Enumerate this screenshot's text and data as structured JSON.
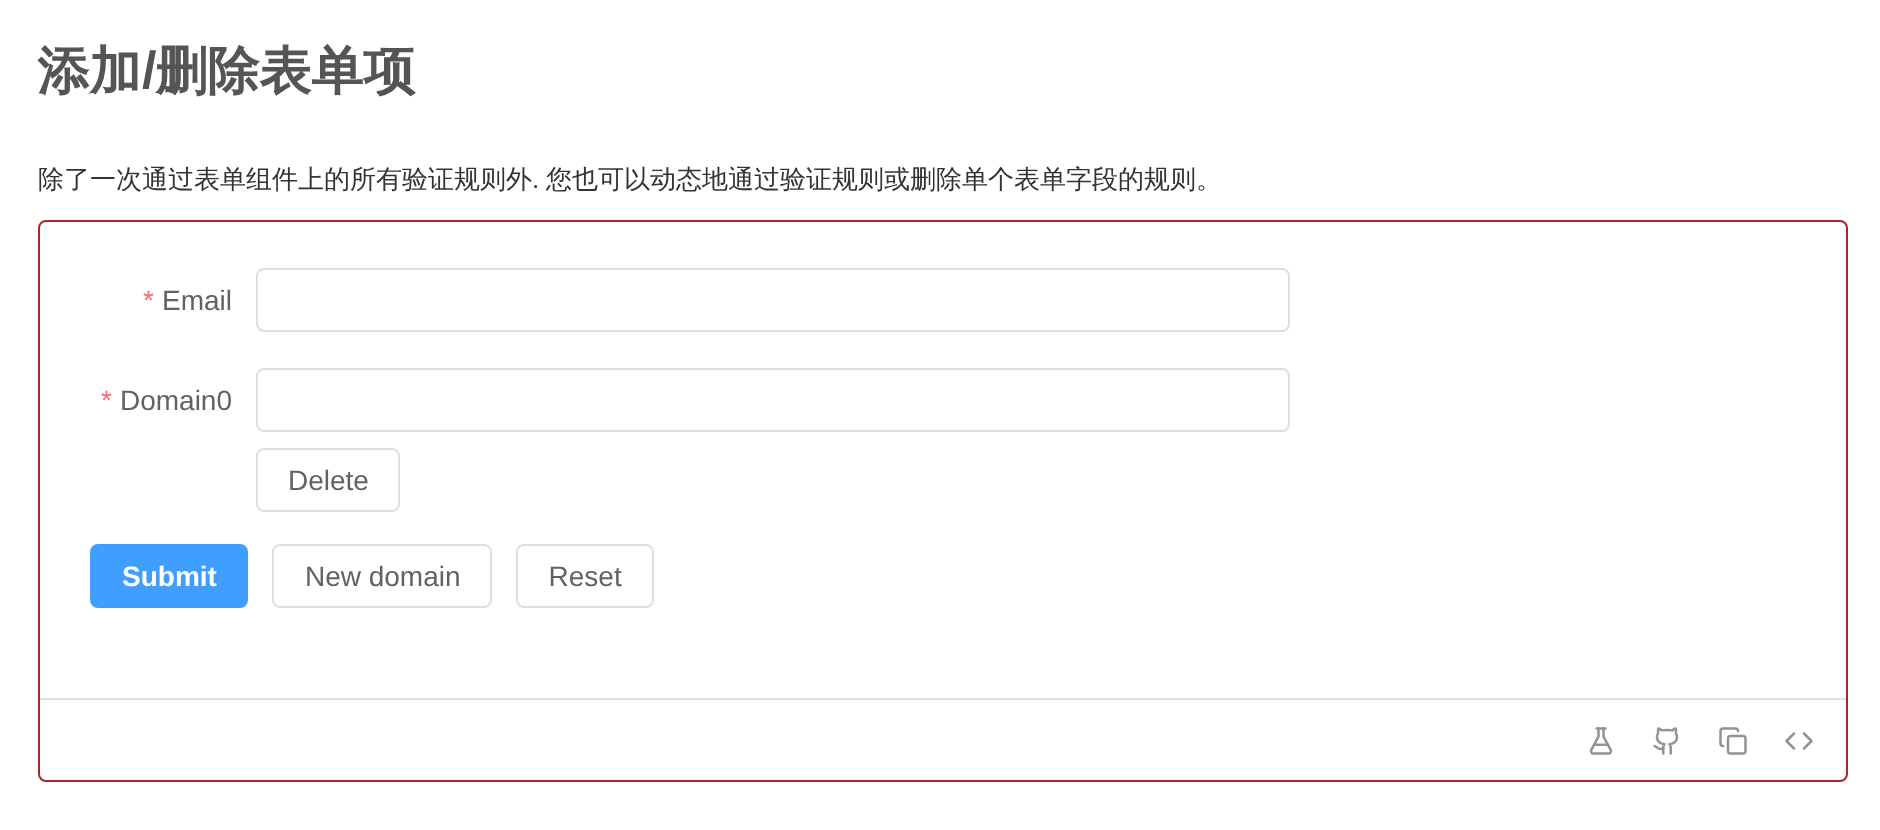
{
  "title": "添加/删除表单项",
  "description": "除了一次通过表单组件上的所有验证规则外. 您也可以动态地通过验证规则或删除单个表单字段的规则。",
  "form": {
    "fields": [
      {
        "label": "Email",
        "required_mark": "*"
      },
      {
        "label": "Domain0",
        "required_mark": "*",
        "delete_button": "Delete"
      }
    ],
    "actions": [
      {
        "label": "Submit",
        "kind": "primary"
      },
      {
        "label": "New domain",
        "kind": "default"
      },
      {
        "label": "Reset",
        "kind": "default"
      }
    ]
  }
}
